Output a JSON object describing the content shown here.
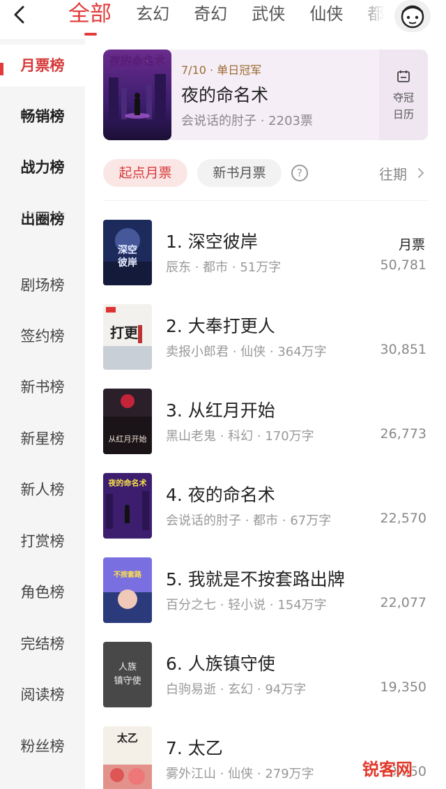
{
  "categories": [
    "全部",
    "玄幻",
    "奇幻",
    "武侠",
    "仙侠",
    "都"
  ],
  "sidebar": {
    "items": [
      {
        "label": "月票榜",
        "state": "active"
      },
      {
        "label": "畅销榜",
        "state": "strong"
      },
      {
        "label": "战力榜",
        "state": "strong"
      },
      {
        "label": "出圈榜",
        "state": "strong"
      },
      {
        "label": "剧场榜",
        "state": "normal"
      },
      {
        "label": "签约榜",
        "state": "normal"
      },
      {
        "label": "新书榜",
        "state": "normal"
      },
      {
        "label": "新星榜",
        "state": "normal"
      },
      {
        "label": "新人榜",
        "state": "normal"
      },
      {
        "label": "打赏榜",
        "state": "normal"
      },
      {
        "label": "角色榜",
        "state": "normal"
      },
      {
        "label": "完结榜",
        "state": "normal"
      },
      {
        "label": "阅读榜",
        "state": "normal"
      },
      {
        "label": "粉丝榜",
        "state": "normal"
      }
    ]
  },
  "champion": {
    "badge": "7/10 · 单日冠军",
    "title": "夜的命名术",
    "subtitle": "会说话的肘子 · 2203票",
    "calendar_line1": "夺冠",
    "calendar_line2": "日历"
  },
  "filters": {
    "active": "起点月票",
    "secondary": "新书月票",
    "help": "?",
    "past": "往期"
  },
  "list": {
    "column_label": "月票",
    "books": [
      {
        "title": "1. 深空彼岸",
        "meta": "辰东 · 都市 · 51万字",
        "votes": "50,781"
      },
      {
        "title": "2. 大奉打更人",
        "meta": "卖报小郎君 · 仙侠 · 364万字",
        "votes": "30,851"
      },
      {
        "title": "3. 从红月开始",
        "meta": "黑山老鬼 · 科幻 · 170万字",
        "votes": "26,773"
      },
      {
        "title": "4. 夜的命名术",
        "meta": "会说话的肘子 · 都市 · 67万字",
        "votes": "22,570"
      },
      {
        "title": "5. 我就是不按套路出牌",
        "meta": "百分之七 · 轻小说 · 154万字",
        "votes": "22,077"
      },
      {
        "title": "6. 人族镇守使",
        "meta": "白驹易逝 · 玄幻 · 94万字",
        "votes": "19,350"
      },
      {
        "title": "7. 太乙",
        "meta": "雾外江山 · 仙侠 · 279万字",
        "votes": "19,350"
      }
    ]
  },
  "watermark": "锐客网",
  "colors": {
    "accent": "#e23b3b",
    "sidebar_bg": "#f5f5f5",
    "champion_bg": "#f6eef7"
  }
}
